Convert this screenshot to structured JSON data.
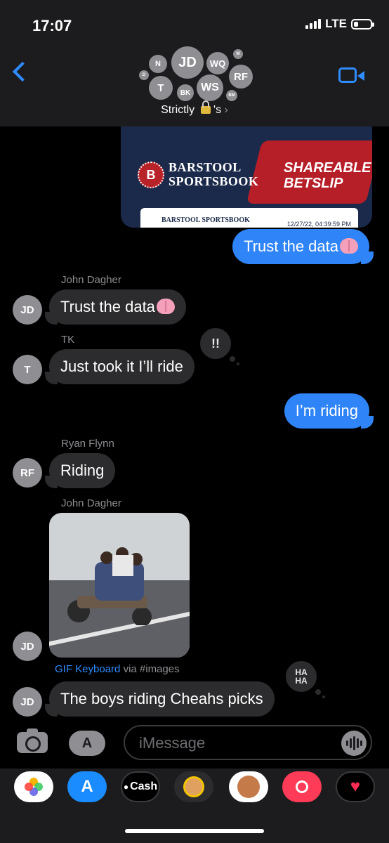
{
  "status_bar": {
    "time": "17:07",
    "network": "LTE"
  },
  "header": {
    "group_name": "Strictly",
    "group_name_suffix": "'s",
    "avatars": [
      "N",
      "JD",
      "WQ",
      "M",
      "D",
      "RF",
      "T",
      "WS",
      "BK",
      "BM"
    ]
  },
  "betslip": {
    "brand_line1": "BARSTOOL",
    "brand_line2": "SPORTSBOOK",
    "promo_line1": "SHAREABLE",
    "promo_line2": "BETSLIP",
    "slip_brand": "BARSTOOL SPORTSBOOK",
    "slip_date": "12/27/22, 04:39:59 PM"
  },
  "messages": [
    {
      "direction": "out",
      "text": "Trust the data"
    },
    {
      "sender": "John Dagher",
      "initials": "JD",
      "direction": "in",
      "text": "Trust the data"
    },
    {
      "sender": "TK",
      "initials": "T",
      "direction": "in",
      "text": "Just took it I’ll ride",
      "tapback": "!!"
    },
    {
      "direction": "out",
      "text": "I’m riding"
    },
    {
      "sender": "Ryan Flynn",
      "initials": "RF",
      "direction": "in",
      "text": "Riding"
    },
    {
      "sender": "John Dagher",
      "initials": "JD",
      "direction": "in",
      "type": "gif"
    },
    {
      "initials": "JD",
      "direction": "in",
      "text": "The boys riding Cheahs picks",
      "tapback": "HA HA"
    }
  ],
  "gif_caption": {
    "source": "GIF Keyboard",
    "via": "via #images"
  },
  "composer": {
    "placeholder": "iMessage"
  },
  "app_drawer": {
    "cash_label": "Cash"
  }
}
